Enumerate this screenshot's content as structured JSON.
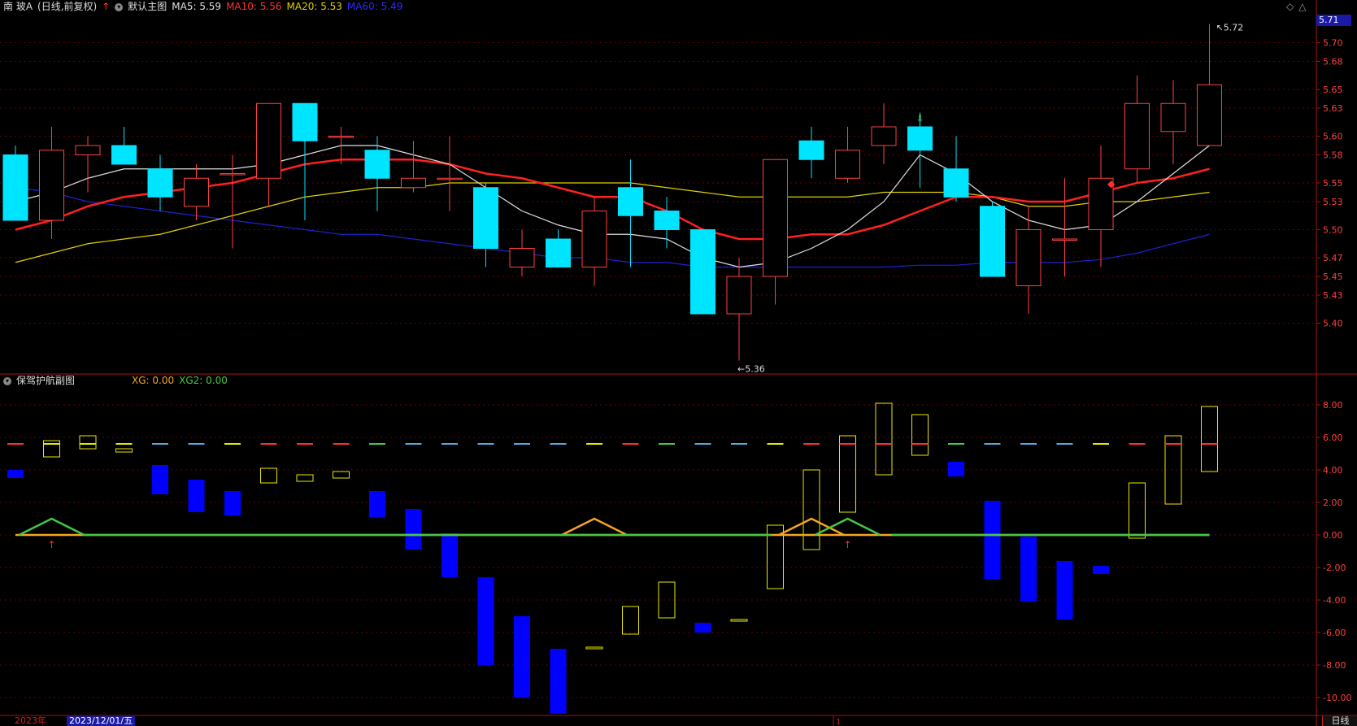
{
  "header": {
    "stock_name": "南  玻A",
    "period": "(日线,前复权)",
    "main_chart": "默认主图",
    "ma5_label": "MA5: 5.59",
    "ma10_label": "MA10: 5.56",
    "ma20_label": "MA20: 5.53",
    "ma60_label": "MA60: 5.49",
    "sub_chart": "保驾护航副图",
    "xg_label": "XG: 0.00",
    "xg2_label": "XG2: 0.00",
    "current_price": "5.71",
    "high_marker": "5.72",
    "low_marker": "5.36"
  },
  "colors": {
    "up": "#ff4040",
    "down": "#00e5ff",
    "ma5": "#e0e0e0",
    "ma10": "#ff2020",
    "ma20": "#e0d000",
    "ma60": "#2020d0",
    "grid": "#6a0000",
    "xg": "#f5a623",
    "xg2": "#45c845",
    "sub_up": "#e8e800",
    "sub_down": "#0000ff"
  },
  "footer": {
    "year": "2023年",
    "date": "2023/12/01/五",
    "period_button": "日线",
    "month_tick": "1"
  },
  "chart_data": [
    {
      "type": "candlestick",
      "title": "默认主图",
      "ylim": [
        5.35,
        5.73
      ],
      "y_ticks": [
        "5.70",
        "5.68",
        "5.65",
        "5.63",
        "5.60",
        "5.58",
        "5.55",
        "5.53",
        "5.50",
        "5.47",
        "5.45",
        "5.43",
        "5.40"
      ],
      "candles": [
        {
          "o": 5.58,
          "h": 5.59,
          "l": 5.51,
          "c": 5.51
        },
        {
          "o": 5.51,
          "h": 5.61,
          "l": 5.49,
          "c": 5.585
        },
        {
          "o": 5.58,
          "h": 5.6,
          "l": 5.54,
          "c": 5.59
        },
        {
          "o": 5.59,
          "h": 5.61,
          "l": 5.57,
          "c": 5.57
        },
        {
          "o": 5.565,
          "h": 5.58,
          "l": 5.52,
          "c": 5.535
        },
        {
          "o": 5.525,
          "h": 5.57,
          "l": 5.51,
          "c": 5.555
        },
        {
          "o": 5.56,
          "h": 5.58,
          "l": 5.48,
          "c": 5.56
        },
        {
          "o": 5.555,
          "h": 5.635,
          "l": 5.525,
          "c": 5.635
        },
        {
          "o": 5.635,
          "h": 5.63,
          "l": 5.51,
          "c": 5.595
        },
        {
          "o": 5.6,
          "h": 5.61,
          "l": 5.57,
          "c": 5.6
        },
        {
          "o": 5.585,
          "h": 5.6,
          "l": 5.52,
          "c": 5.555
        },
        {
          "o": 5.545,
          "h": 5.595,
          "l": 5.54,
          "c": 5.555
        },
        {
          "o": 5.555,
          "h": 5.6,
          "l": 5.52,
          "c": 5.555
        },
        {
          "o": 5.545,
          "h": 5.55,
          "l": 5.46,
          "c": 5.48
        },
        {
          "o": 5.46,
          "h": 5.5,
          "l": 5.45,
          "c": 5.48
        },
        {
          "o": 5.49,
          "h": 5.5,
          "l": 5.46,
          "c": 5.46
        },
        {
          "o": 5.46,
          "h": 5.535,
          "l": 5.44,
          "c": 5.52
        },
        {
          "o": 5.545,
          "h": 5.575,
          "l": 5.46,
          "c": 5.515
        },
        {
          "o": 5.52,
          "h": 5.535,
          "l": 5.48,
          "c": 5.5
        },
        {
          "o": 5.5,
          "h": 5.5,
          "l": 5.41,
          "c": 5.41
        },
        {
          "o": 5.41,
          "h": 5.47,
          "l": 5.36,
          "c": 5.45
        },
        {
          "o": 5.45,
          "h": 5.575,
          "l": 5.42,
          "c": 5.575
        },
        {
          "o": 5.595,
          "h": 5.61,
          "l": 5.555,
          "c": 5.575
        },
        {
          "o": 5.555,
          "h": 5.61,
          "l": 5.55,
          "c": 5.585
        },
        {
          "o": 5.59,
          "h": 5.635,
          "l": 5.57,
          "c": 5.61
        },
        {
          "o": 5.61,
          "h": 5.625,
          "l": 5.545,
          "c": 5.585
        },
        {
          "o": 5.565,
          "h": 5.6,
          "l": 5.53,
          "c": 5.535
        },
        {
          "o": 5.525,
          "h": 5.53,
          "l": 5.45,
          "c": 5.45
        },
        {
          "o": 5.44,
          "h": 5.525,
          "l": 5.41,
          "c": 5.5
        },
        {
          "o": 5.49,
          "h": 5.555,
          "l": 5.45,
          "c": 5.49
        },
        {
          "o": 5.5,
          "h": 5.59,
          "l": 5.46,
          "c": 5.555
        },
        {
          "o": 5.565,
          "h": 5.665,
          "l": 5.55,
          "c": 5.635
        },
        {
          "o": 5.605,
          "h": 5.66,
          "l": 5.57,
          "c": 5.635
        },
        {
          "o": 5.59,
          "h": 5.72,
          "l": 5.59,
          "c": 5.655
        }
      ],
      "series": [
        {
          "name": "MA5",
          "values": [
            5.53,
            5.54,
            5.555,
            5.565,
            5.565,
            5.565,
            5.565,
            5.57,
            5.58,
            5.59,
            5.59,
            5.58,
            5.57,
            5.545,
            5.52,
            5.505,
            5.495,
            5.495,
            5.49,
            5.47,
            5.46,
            5.465,
            5.48,
            5.5,
            5.53,
            5.58,
            5.56,
            5.53,
            5.51,
            5.5,
            5.505,
            5.53,
            5.56,
            5.59
          ]
        },
        {
          "name": "MA10",
          "values": [
            5.5,
            5.51,
            5.525,
            5.535,
            5.54,
            5.545,
            5.55,
            5.56,
            5.57,
            5.575,
            5.575,
            5.575,
            5.57,
            5.56,
            5.555,
            5.545,
            5.535,
            5.535,
            5.52,
            5.5,
            5.49,
            5.49,
            5.495,
            5.495,
            5.505,
            5.52,
            5.535,
            5.535,
            5.53,
            5.53,
            5.54,
            5.55,
            5.555,
            5.565
          ]
        },
        {
          "name": "MA20",
          "values": [
            5.465,
            5.475,
            5.485,
            5.49,
            5.495,
            5.505,
            5.515,
            5.525,
            5.535,
            5.54,
            5.545,
            5.545,
            5.55,
            5.55,
            5.55,
            5.55,
            5.55,
            5.55,
            5.545,
            5.54,
            5.535,
            5.535,
            5.535,
            5.535,
            5.54,
            5.54,
            5.54,
            5.535,
            5.525,
            5.525,
            5.53,
            5.53,
            5.535,
            5.54
          ]
        },
        {
          "name": "MA60",
          "values": [
            5.545,
            5.54,
            5.53,
            5.525,
            5.52,
            5.515,
            5.51,
            5.505,
            5.5,
            5.495,
            5.495,
            5.49,
            5.485,
            5.48,
            5.475,
            5.47,
            5.47,
            5.465,
            5.465,
            5.46,
            5.46,
            5.46,
            5.46,
            5.46,
            5.46,
            5.462,
            5.462,
            5.465,
            5.465,
            5.465,
            5.468,
            5.475,
            5.485,
            5.495
          ]
        }
      ]
    },
    {
      "type": "bar",
      "title": "保驾护航副图",
      "ylim": [
        -11,
        9
      ],
      "y_ticks": [
        "8.00",
        "6.00",
        "4.00",
        "2.00",
        "0.00",
        "-2.00",
        "-4.00",
        "-6.00",
        "-8.00",
        "-10.00"
      ],
      "bars": [
        {
          "a": 3.5,
          "b": 4.0,
          "up": false
        },
        {
          "a": 4.8,
          "b": 5.8,
          "up": true
        },
        {
          "a": 5.3,
          "b": 6.1,
          "up": true
        },
        {
          "a": 5.1,
          "b": 5.3,
          "up": true
        },
        {
          "a": 2.5,
          "b": 4.3,
          "up": false
        },
        {
          "a": 1.4,
          "b": 3.4,
          "up": false
        },
        {
          "a": 1.2,
          "b": 2.7,
          "up": false
        },
        {
          "a": 3.2,
          "b": 4.1,
          "up": true
        },
        {
          "a": 3.3,
          "b": 3.7,
          "up": true
        },
        {
          "a": 3.5,
          "b": 3.9,
          "up": true
        },
        {
          "a": 1.1,
          "b": 2.7,
          "up": false
        },
        {
          "a": -0.9,
          "b": 1.6,
          "up": false
        },
        {
          "a": -2.6,
          "b": 0.1,
          "up": false
        },
        {
          "a": -8.0,
          "b": -2.6,
          "up": false
        },
        {
          "a": -10.0,
          "b": -5.0,
          "up": false
        },
        {
          "a": -11.0,
          "b": -7.0,
          "up": false
        },
        {
          "a": -7.0,
          "b": -6.9,
          "up": true
        },
        {
          "a": -6.1,
          "b": -4.4,
          "up": true
        },
        {
          "a": -5.1,
          "b": -2.9,
          "up": true
        },
        {
          "a": -6.0,
          "b": -5.4,
          "up": false
        },
        {
          "a": -5.3,
          "b": -5.2,
          "up": true
        },
        {
          "a": -3.3,
          "b": 0.6,
          "up": true
        },
        {
          "a": -0.9,
          "b": 4.0,
          "up": true
        },
        {
          "a": 1.4,
          "b": 6.1,
          "up": true
        },
        {
          "a": 3.7,
          "b": 8.1,
          "up": true
        },
        {
          "a": 4.9,
          "b": 7.4,
          "up": true
        },
        {
          "a": 3.6,
          "b": 4.5,
          "up": false
        },
        {
          "a": -2.7,
          "b": 2.1,
          "up": false
        },
        {
          "a": -4.1,
          "b": -0.1,
          "up": false
        },
        {
          "a": -5.2,
          "b": -1.6,
          "up": false
        },
        {
          "a": -2.4,
          "b": -1.9,
          "up": false
        },
        {
          "a": -0.2,
          "b": 3.2,
          "up": true
        },
        {
          "a": 1.9,
          "b": 6.1,
          "up": true
        },
        {
          "a": 3.9,
          "b": 7.9,
          "up": true
        }
      ],
      "dash_line": {
        "value": 5.6,
        "colors": [
          "#ff3030",
          "#e8e800",
          "#e8e800",
          "#e8e800",
          "#5ad",
          "#5ad",
          "#e8e800",
          "#ff3030",
          "#ff3030",
          "#ff3030",
          "#45c845",
          "#5ad",
          "#5ad",
          "#5ad",
          "#5ad",
          "#5ad",
          "#e8e800",
          "#ff3030",
          "#45c845",
          "#5ad",
          "#5ad",
          "#e8e800",
          "#ff3030",
          "#ff3030",
          "#ff3030",
          "#ff3030",
          "#45c845",
          "#5ad",
          "#5ad",
          "#5ad",
          "#e8e800",
          "#ff3030",
          "#ff3030",
          "#ff3030"
        ]
      },
      "xg_peaks": [
        11,
        16,
        17,
        18,
        21,
        22,
        23
      ],
      "xg2_peaks": [
        1,
        23
      ],
      "arrows": [
        1,
        23
      ]
    }
  ]
}
